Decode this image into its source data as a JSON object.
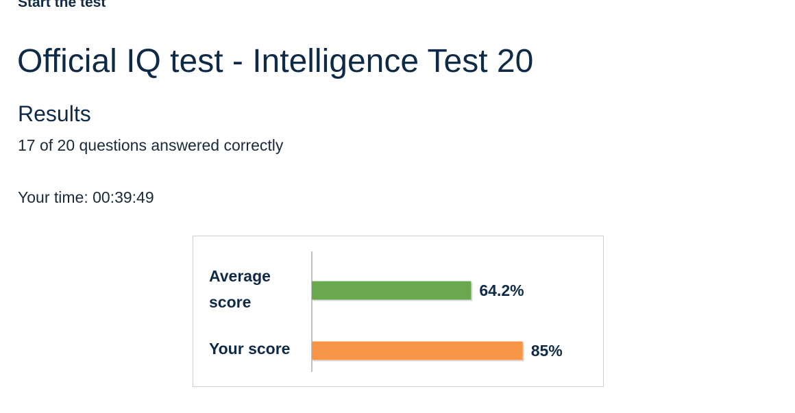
{
  "header": {
    "start_link": "Start the test"
  },
  "page": {
    "title": "Official IQ test - Intelligence Test 20",
    "results_heading": "Results",
    "answered_text": "17 of 20 questions answered correctly",
    "time_label": "Your time: 00:39:49"
  },
  "chart_data": {
    "type": "bar",
    "orientation": "horizontal",
    "categories": [
      "Average score",
      "Your score"
    ],
    "category_lines": [
      [
        "Average",
        "score"
      ],
      [
        "Your score"
      ]
    ],
    "values": [
      64.2,
      85
    ],
    "value_labels": [
      "64.2%",
      "85%"
    ],
    "colors": [
      "#6aa84f",
      "#f79646"
    ],
    "xlim": [
      0,
      100
    ],
    "grid": false
  }
}
